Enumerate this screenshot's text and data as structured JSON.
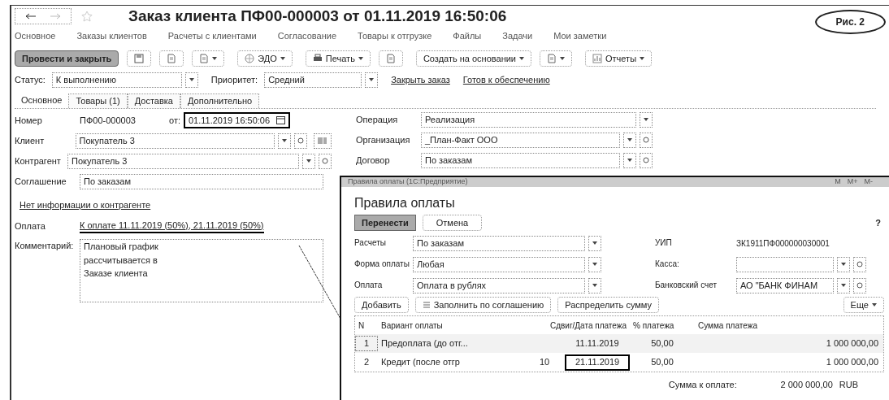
{
  "window": {
    "title": "Заказ клиента ПФ00-000003 от 01.11.2019 16:50:06"
  },
  "figure_label": "Рис. 2",
  "nav": [
    "Основное",
    "Заказы клиентов",
    "Расчеты с клиентами",
    "Согласование",
    "Товары к отгрузке",
    "Файлы",
    "Задачи",
    "Мои заметки"
  ],
  "toolbar": [
    {
      "kind": "primary",
      "label": "Провести и закрыть"
    },
    {
      "kind": "icon"
    },
    {
      "kind": "icon"
    },
    {
      "kind": "icondrop"
    },
    {
      "kind": "drop",
      "label": "ЭДО"
    },
    {
      "kind": "drop",
      "label": "Печать"
    },
    {
      "kind": "icon"
    },
    {
      "kind": "drop",
      "label": "Создать на основании"
    },
    {
      "kind": "icondrop"
    },
    {
      "kind": "drop",
      "label": "Отчеты"
    }
  ],
  "status": {
    "label": "Статус:",
    "value": "К выполнению",
    "priority_label": "Приоритет:",
    "priority": "Средний",
    "links": [
      "Закрыть заказ",
      "Готов к обеспечению"
    ]
  },
  "tabs": [
    {
      "label": "Основное",
      "selected": true
    },
    {
      "label": "Товары (1)",
      "selected": false
    },
    {
      "label": "Доставка",
      "selected": false
    },
    {
      "label": "Дополнительно",
      "selected": false
    }
  ],
  "number": {
    "label": "Номер",
    "value": "ПФ00-000003",
    "date_label": "от:",
    "date": "01.11.2019 16:50:06",
    "highlighted": true
  },
  "left_fields": [
    {
      "label": "Клиент",
      "value": "Покупатель 3"
    },
    {
      "label": "Контрагент",
      "value": "Покупатель 3"
    },
    {
      "label": "Соглашение",
      "value": "По заказам"
    }
  ],
  "right_fields": [
    {
      "label": "Операция",
      "value": "Реализация"
    },
    {
      "label": "Организация",
      "value": "_План-Факт ООО"
    },
    {
      "label": "Договор",
      "value": "По заказам"
    }
  ],
  "info_link": "Нет информации о контрагенте",
  "payment": {
    "label": "Оплата",
    "link": "К оплате 11.11.2019 (50%), 21.11.2019 (50%)"
  },
  "comment": {
    "label": "Комментарий:",
    "value": "Плановый график\nрассчитывается в\nЗаказе клиента"
  },
  "dialog": {
    "title": "Правила оплаты (1С:Предприятие)",
    "title_buttons": [
      "M",
      "M+",
      "M-"
    ],
    "heading": "Правила оплаты",
    "ok": "Перенести",
    "cancel": "Отмена",
    "help": "?",
    "fields": [
      {
        "label": "Расчеты",
        "value": "По заказам"
      },
      {
        "label": "Форма оплаты",
        "value": "Любая"
      },
      {
        "label": "Оплата",
        "value": "Оплата в рублях"
      }
    ],
    "uip_label": "УИП",
    "uip": "ЗК1911ПФ000000030001",
    "cash_label": "Касса:",
    "bank_label": "Банковский счет",
    "bank": "АО \"БАНК ФИНАМ",
    "actions": [
      "Добавить",
      "Заполнить по соглашению",
      "Распределить сумму"
    ],
    "more": "Еще",
    "columns": [
      "N",
      "Вариант оплаты",
      "Сдвиг/Дата платежа",
      "% платежа",
      "Сумма платежа"
    ],
    "rows": [
      {
        "n": "1",
        "variant": "Предоплата (до отг...",
        "shift": "",
        "date": "11.11.2019",
        "percent": "50,00",
        "sum": "1 000 000,00",
        "selected": true,
        "highlighted": false
      },
      {
        "n": "2",
        "variant": "Кредит (после отгр",
        "shift": "10",
        "date": "21.11.2019",
        "percent": "50,00",
        "sum": "1 000 000,00",
        "selected": false,
        "highlighted": true
      }
    ],
    "total_label": "Сумма к оплате:",
    "total": "2 000 000,00",
    "currency": "RUB"
  }
}
